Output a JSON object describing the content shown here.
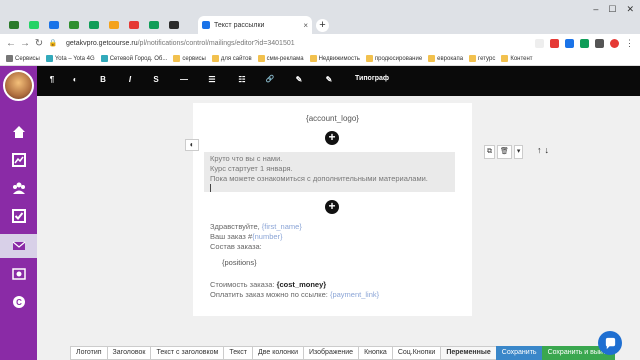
{
  "browser": {
    "tab_colors": [
      "#2a7a2a",
      "#25d366",
      "#1a73e8",
      "#2f8f2f",
      "#0f9d58",
      "#f4a21b",
      "#e53935",
      "#ffffff",
      "#2c2c2c"
    ],
    "active_tab_title": "Текст рассылки",
    "new_tab": "+",
    "url_host": "getakvpro.getcourse.ru",
    "url_path": "/pl/notifications/control/mailings/editor?id=3401501",
    "bookmarks": [
      "Сервисы",
      "Yota – Yota 4G",
      "Сетевой Город. Об...",
      "сервисы",
      "для сайтов",
      "смм-реклама",
      "Недвижимость",
      "продюсирование",
      "еврокапа",
      "гетурс",
      "Контент"
    ]
  },
  "toolbar": {
    "buttons": [
      "¶",
      "◐",
      "B",
      "I",
      "S",
      "—",
      "☰",
      "☷",
      "🔗",
      "✎",
      "✎"
    ],
    "typograph": "Типограф"
  },
  "editor": {
    "logo_var": "{account_logo}",
    "plus": "+",
    "block1_lines": [
      "Круто что вы с нами.",
      "Курс стартует 1 января.",
      "Пока можете ознакомиться с дополнительными материалами."
    ],
    "greeting_prefix": "Здравствуйте,",
    "greeting_var": "{first_name}",
    "order_prefix": "Ваш заказ #",
    "order_var": "{number}",
    "order_contents": "Состав заказа:",
    "positions_var": "{positions}",
    "cost_prefix": "Стоимость заказа:",
    "cost_var": "{cost_money}",
    "pay_prefix": "Оплатить заказ можно по ссылке:",
    "pay_var": "{payment_link}",
    "half_circle": "◐"
  },
  "block_actions": [
    "⧉",
    "🗑",
    "▾"
  ],
  "arrows": [
    "↑",
    "↓"
  ],
  "bottom_buttons": [
    "Логотип",
    "Заголовок",
    "Текст с заголовком",
    "Текст",
    "Две колонки",
    "Изображение",
    "Кнопка",
    "Соц.Кнопки",
    "Переменные",
    "Сохранить",
    "Сохранить и выйти"
  ],
  "colors": {
    "sidebar": "#8a2ba6",
    "toolbar": "#0a0a0a",
    "save": "#3a87c9",
    "save_exit": "#3aa74f",
    "chat": "#1f6fd1"
  }
}
